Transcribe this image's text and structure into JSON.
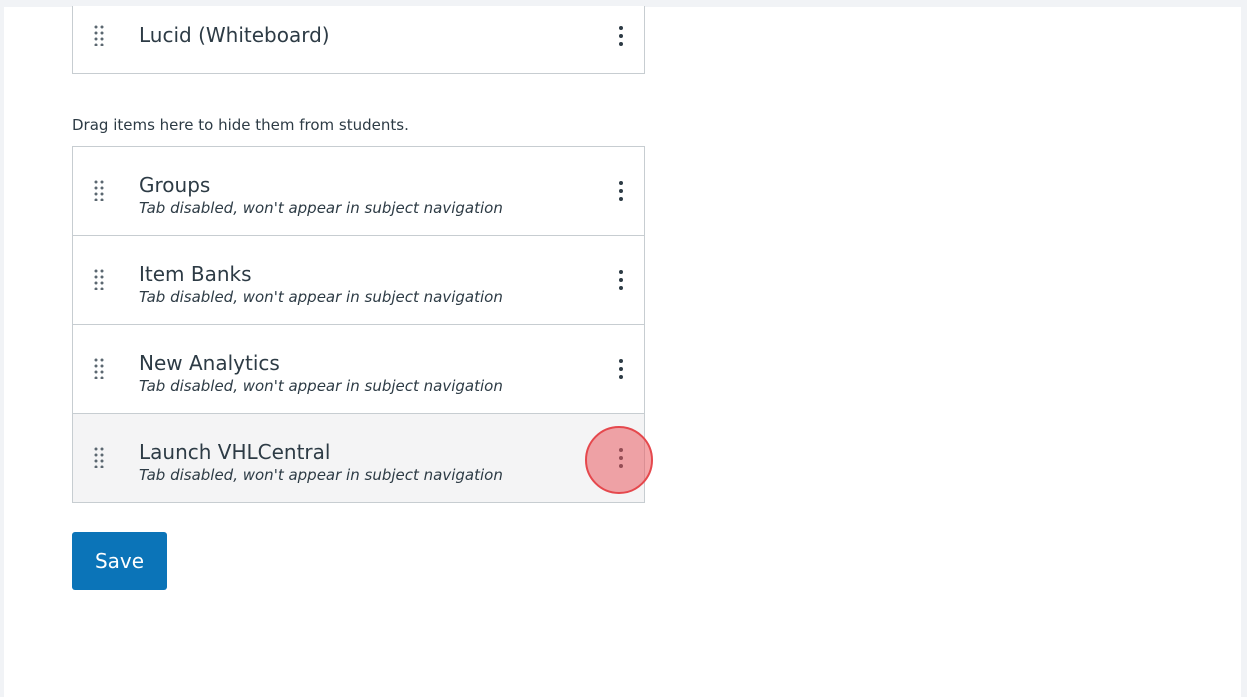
{
  "enabled_items": [
    {
      "title": "Lucid (Whiteboard)"
    }
  ],
  "disabled_section": {
    "hint": "Drag items here to hide them from students.",
    "items": [
      {
        "title": "Groups",
        "subtitle": "Tab disabled, won't appear in subject navigation"
      },
      {
        "title": "Item Banks",
        "subtitle": "Tab disabled, won't appear in subject navigation"
      },
      {
        "title": "New Analytics",
        "subtitle": "Tab disabled, won't appear in subject navigation"
      },
      {
        "title": "Launch VHLCentral",
        "subtitle": "Tab disabled, won't appear in subject navigation"
      }
    ]
  },
  "actions": {
    "save_label": "Save"
  },
  "icons": {
    "drag_handle": "drag-handle-icon",
    "more_options": "more-options-icon"
  },
  "colors": {
    "primary_button": "#0b74b8",
    "click_highlight": "#e95c62",
    "border": "#c7cdd1",
    "text": "#2d3b45"
  }
}
